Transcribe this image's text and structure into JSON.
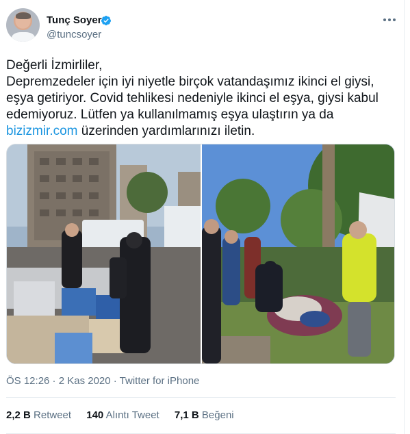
{
  "author": {
    "name": "Tunç Soyer",
    "handle": "@tuncsoyer",
    "verified": true
  },
  "tweet": {
    "line1": "Değerli İzmirliler,",
    "body": "Depremzedeler için iyi niyetle birçok vatandaşımız ikinci el giysi, eşya getiriyor. Covid tehlikesi nedeniyle ikinci el eşya, giysi kabul edemiyoruz. Lütfen ya kullanılmamış eşya ulaştırın ya da ",
    "link": "bizizmir.com",
    "tail": " üzerinden yardımlarınızı iletin."
  },
  "meta": {
    "timestamp": "ÖS 12:26 · 2 Kas 2020 · Twitter for iPhone"
  },
  "stats": {
    "retweets_count": "2,2 B",
    "retweets_label": "Retweet",
    "quotes_count": "140",
    "quotes_label": "Alıntı Tweet",
    "likes_count": "7,1 B",
    "likes_label": "Beğeni"
  },
  "icons": {
    "verified": "verified-badge-icon",
    "more": "more-options-icon"
  },
  "colors": {
    "link": "#1b95e0",
    "secondary_text": "#5b7083",
    "verified": "#1da1f2"
  }
}
